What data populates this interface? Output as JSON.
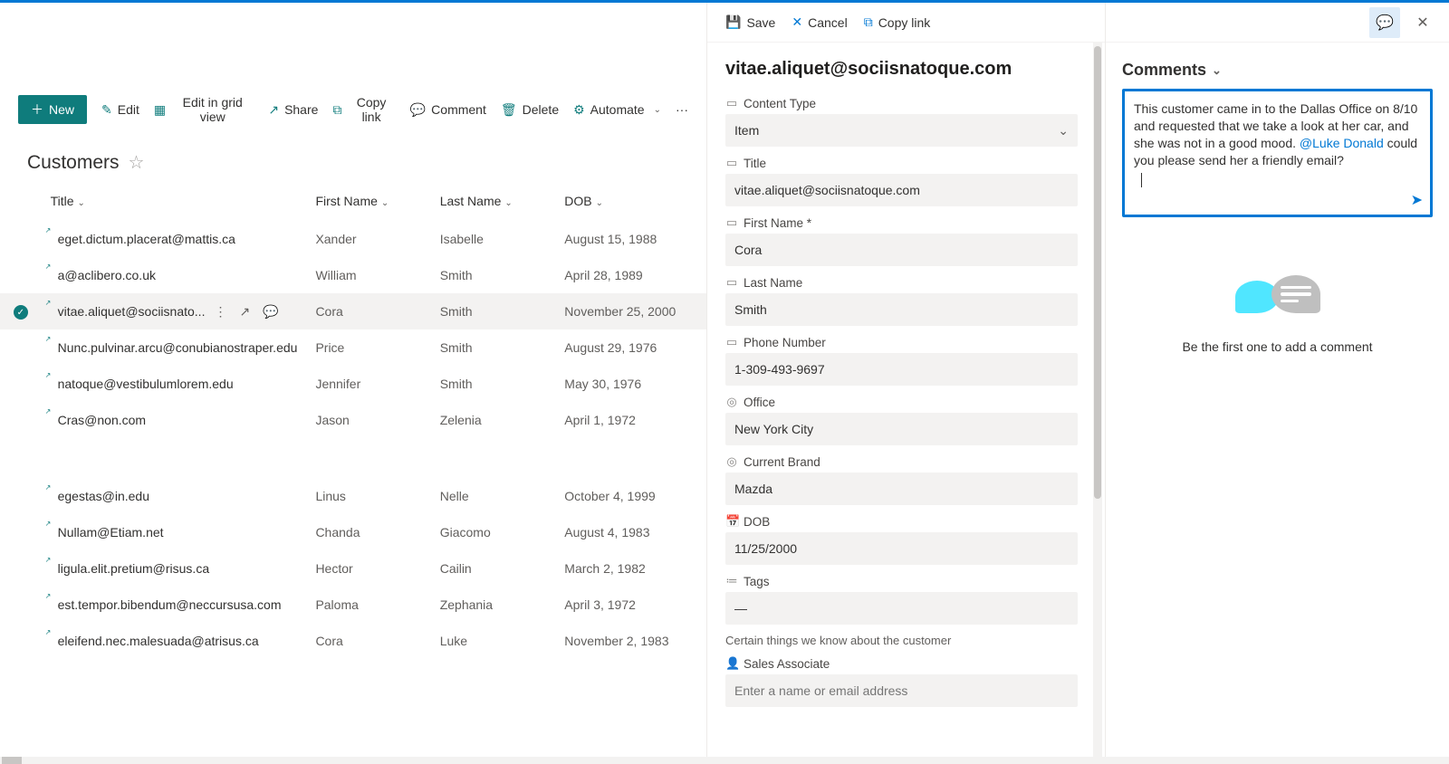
{
  "toolbar": {
    "new": "New",
    "edit": "Edit",
    "edit_grid": "Edit in grid view",
    "share": "Share",
    "copy_link": "Copy link",
    "comment": "Comment",
    "delete": "Delete",
    "automate": "Automate"
  },
  "list": {
    "title": "Customers",
    "columns": {
      "title": "Title",
      "first_name": "First Name",
      "last_name": "Last Name",
      "dob": "DOB"
    },
    "rows": [
      {
        "title": "eget.dictum.placerat@mattis.ca",
        "first_name": "Xander",
        "last_name": "Isabelle",
        "dob": "August 15, 1988"
      },
      {
        "title": "a@aclibero.co.uk",
        "first_name": "William",
        "last_name": "Smith",
        "dob": "April 28, 1989"
      },
      {
        "title": "vitae.aliquet@sociisnato...",
        "first_name": "Cora",
        "last_name": "Smith",
        "dob": "November 25, 2000",
        "selected": true
      },
      {
        "title": "Nunc.pulvinar.arcu@conubianostraper.edu",
        "first_name": "Price",
        "last_name": "Smith",
        "dob": "August 29, 1976"
      },
      {
        "title": "natoque@vestibulumlorem.edu",
        "first_name": "Jennifer",
        "last_name": "Smith",
        "dob": "May 30, 1976"
      },
      {
        "title": "Cras@non.com",
        "first_name": "Jason",
        "last_name": "Zelenia",
        "dob": "April 1, 1972"
      },
      {
        "title": "egestas@in.edu",
        "first_name": "Linus",
        "last_name": "Nelle",
        "dob": "October 4, 1999"
      },
      {
        "title": "Nullam@Etiam.net",
        "first_name": "Chanda",
        "last_name": "Giacomo",
        "dob": "August 4, 1983"
      },
      {
        "title": "ligula.elit.pretium@risus.ca",
        "first_name": "Hector",
        "last_name": "Cailin",
        "dob": "March 2, 1982"
      },
      {
        "title": "est.tempor.bibendum@neccursusa.com",
        "first_name": "Paloma",
        "last_name": "Zephania",
        "dob": "April 3, 1972"
      },
      {
        "title": "eleifend.nec.malesuada@atrisus.ca",
        "first_name": "Cora",
        "last_name": "Luke",
        "dob": "November 2, 1983"
      }
    ]
  },
  "form": {
    "toolbar": {
      "save": "Save",
      "cancel": "Cancel",
      "copy_link": "Copy link"
    },
    "heading": "vitae.aliquet@sociisnatoque.com",
    "labels": {
      "content_type": "Content Type",
      "title": "Title",
      "first_name": "First Name *",
      "last_name": "Last Name",
      "phone": "Phone Number",
      "office": "Office",
      "brand": "Current Brand",
      "dob": "DOB",
      "tags": "Tags",
      "sales_assoc": "Sales Associate"
    },
    "values": {
      "content_type": "Item",
      "title": "vitae.aliquet@sociisnatoque.com",
      "first_name": "Cora",
      "last_name": "Smith",
      "phone": "1-309-493-9697",
      "office": "New York City",
      "brand": "Mazda",
      "dob": "11/25/2000",
      "tags": "—",
      "sales_assoc_placeholder": "Enter a name or email address"
    },
    "description": "Certain things we know about the customer"
  },
  "comments": {
    "heading": "Comments",
    "draft_pre": "This customer came in to the Dallas Office on 8/10 and requested that we take a look at her car, and she was not in a good mood. ",
    "draft_mention": "@Luke Donald",
    "draft_post": " could you please send her a friendly email?",
    "empty": "Be the first one to add a comment"
  }
}
